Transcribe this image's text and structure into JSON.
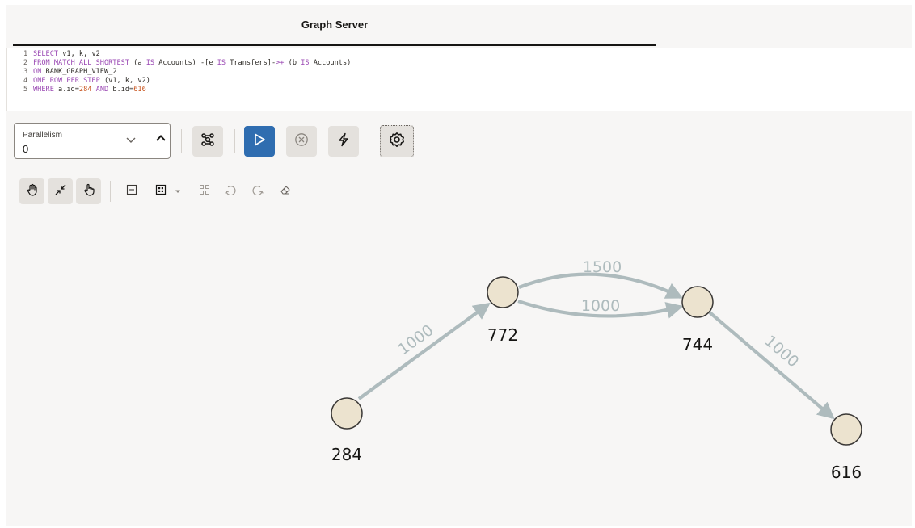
{
  "header": {
    "title": "Graph Server"
  },
  "editor": {
    "lines": [
      {
        "num": "1",
        "parts": [
          {
            "t": "SELECT",
            "c": "kw"
          },
          {
            "t": " v1, k, v2",
            "c": ""
          }
        ]
      },
      {
        "num": "2",
        "parts": [
          {
            "t": "FROM MATCH ALL SHORTEST",
            "c": "kw"
          },
          {
            "t": " (a ",
            "c": ""
          },
          {
            "t": "IS",
            "c": "kw"
          },
          {
            "t": " Accounts) -[e ",
            "c": ""
          },
          {
            "t": "IS",
            "c": "kw"
          },
          {
            "t": " Transfers]-",
            "c": ""
          },
          {
            "t": ">+",
            "c": "kw"
          },
          {
            "t": " (b ",
            "c": ""
          },
          {
            "t": "IS",
            "c": "kw"
          },
          {
            "t": " Accounts)",
            "c": ""
          }
        ]
      },
      {
        "num": "3",
        "parts": [
          {
            "t": "ON",
            "c": "kw"
          },
          {
            "t": " BANK_GRAPH_VIEW_2",
            "c": ""
          }
        ]
      },
      {
        "num": "4",
        "parts": [
          {
            "t": "ONE ROW PER STEP",
            "c": "kw"
          },
          {
            "t": " (v1, k, v2)",
            "c": ""
          }
        ]
      },
      {
        "num": "5",
        "parts": [
          {
            "t": "WHERE",
            "c": "kw"
          },
          {
            "t": " a.id=",
            "c": ""
          },
          {
            "t": "284",
            "c": "num"
          },
          {
            "t": " ",
            "c": ""
          },
          {
            "t": "AND",
            "c": "kw"
          },
          {
            "t": " b.id=",
            "c": ""
          },
          {
            "t": "616",
            "c": "num"
          }
        ]
      }
    ]
  },
  "toolbar": {
    "parallelism_label": "Parallelism",
    "parallelism_value": "0",
    "icons": [
      "graph-modeler-icon",
      "run-icon",
      "cancel-icon",
      "flash-icon",
      "settings-icon"
    ]
  },
  "viz_toolbar": {
    "icons": [
      "pan-icon",
      "collapse-icon",
      "select-hand-icon",
      "minimize-icon",
      "layout-grid-icon",
      "dropdown-caret-icon",
      "group-icon",
      "undo-icon",
      "redo-icon",
      "eraser-icon"
    ]
  },
  "graph": {
    "nodes": [
      {
        "id": "284",
        "label": "284"
      },
      {
        "id": "772",
        "label": "772"
      },
      {
        "id": "744",
        "label": "744"
      },
      {
        "id": "616",
        "label": "616"
      }
    ],
    "edges": [
      {
        "from": "284",
        "to": "772",
        "label": "1000"
      },
      {
        "from": "772",
        "to": "744",
        "label": "1500"
      },
      {
        "from": "772",
        "to": "744",
        "label": "1000"
      },
      {
        "from": "744",
        "to": "616",
        "label": "1000"
      }
    ],
    "colors": {
      "node_fill": "#ece3cf",
      "node_stroke": "#3a3836",
      "edge": "#aebbbd"
    }
  }
}
